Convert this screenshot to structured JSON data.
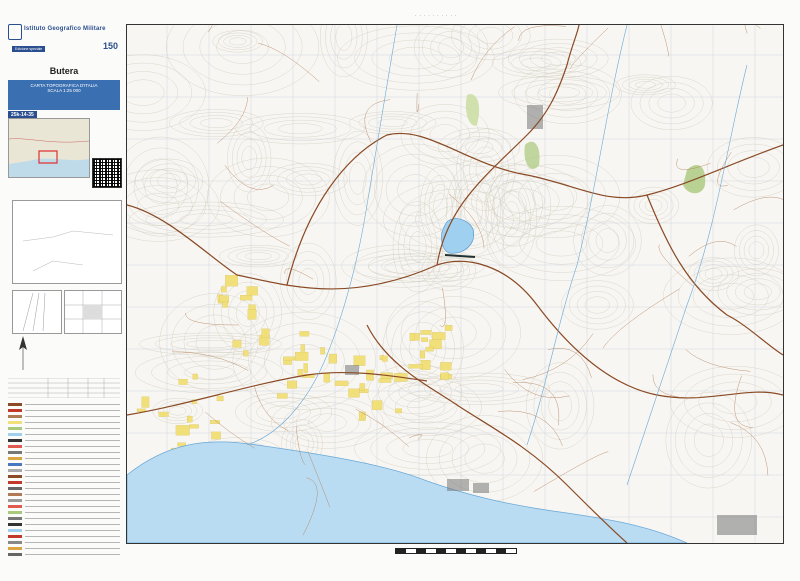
{
  "header": {
    "institute_name": "Istituto Geografico Militare",
    "edition_badge": "Edizione speciale"
  },
  "sheet": {
    "name": "Butera",
    "series_title": "CARTA TOPOGRAFICA D'ITALIA",
    "scale_text": "SCALA 1:25 000",
    "sheet_code": "25k-14-35"
  },
  "colors": {
    "sea": "#b9dcf3",
    "lake": "#9fd0f0",
    "road_main": "#8a4a25",
    "road_minor": "#b07a55",
    "contour": "#c9c2b4",
    "field_yellow": "#f1df7a",
    "vegetation": "#a9c97c",
    "frame": "#333333",
    "header_blue": "#2a4e8f",
    "panel_blue": "#3a6fb2"
  },
  "icons": {
    "emblem": "republic-emblem-icon",
    "north_arrow": "north-arrow-icon",
    "qr": "qr-code-icon"
  }
}
